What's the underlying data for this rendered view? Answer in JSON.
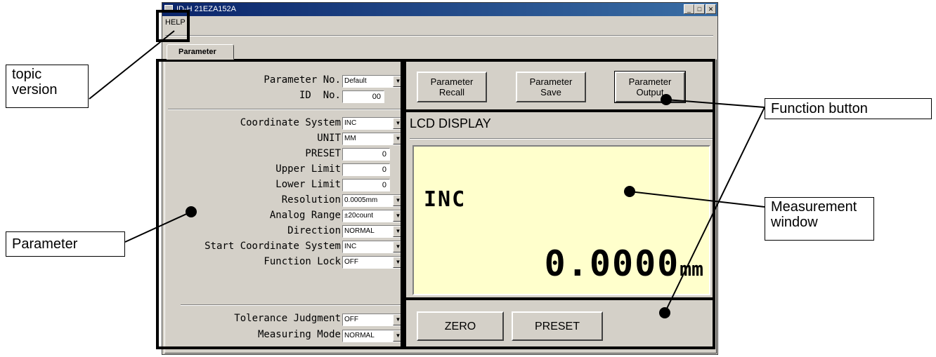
{
  "window": {
    "title": "ID-H 21EZA152A",
    "min_glyph": "_",
    "max_glyph": "□",
    "close_glyph": "✕"
  },
  "menu": {
    "help": "HELP"
  },
  "tabs": [
    {
      "label": "Parameter"
    }
  ],
  "parameters": {
    "parameter_no": {
      "label": "Parameter No.",
      "value": "Default"
    },
    "id_no": {
      "label": "ID  No.",
      "value": "00"
    },
    "coordinate_system": {
      "label": "Coordinate System",
      "value": "INC"
    },
    "unit": {
      "label": "UNIT",
      "value": "MM"
    },
    "preset": {
      "label": "PRESET",
      "value": "0"
    },
    "upper_limit": {
      "label": "Upper Limit",
      "value": "0"
    },
    "lower_limit": {
      "label": "Lower Limit",
      "value": "0"
    },
    "resolution": {
      "label": "Resolution",
      "value": "0.0005mm"
    },
    "analog_range": {
      "label": "Analog Range",
      "value": "±20count"
    },
    "direction": {
      "label": "Direction",
      "value": "NORMAL"
    },
    "start_coordinate_system": {
      "label": "Start Coordinate System",
      "value": "INC"
    },
    "function_lock": {
      "label": "Function Lock",
      "value": "OFF"
    },
    "tolerance_judgment": {
      "label": "Tolerance Judgment",
      "value": "OFF"
    },
    "measuring_mode": {
      "label": "Measuring Mode",
      "value": "NORMAL"
    }
  },
  "functions": {
    "recall": "Parameter\nRecall",
    "save": "Parameter\nSave",
    "output": "Parameter\nOutput"
  },
  "lcd": {
    "title": "LCD DISPLAY",
    "mode": "INC",
    "value": "0.0000",
    "unit": "mm"
  },
  "bottom_buttons": {
    "zero": "ZERO",
    "preset": "PRESET"
  },
  "combo_arrow": "▼",
  "annotations": {
    "topic_version": "topic\nversion",
    "parameter": "Parameter",
    "function_button": "Function button",
    "measurement_window": "Measurement\nwindow"
  }
}
